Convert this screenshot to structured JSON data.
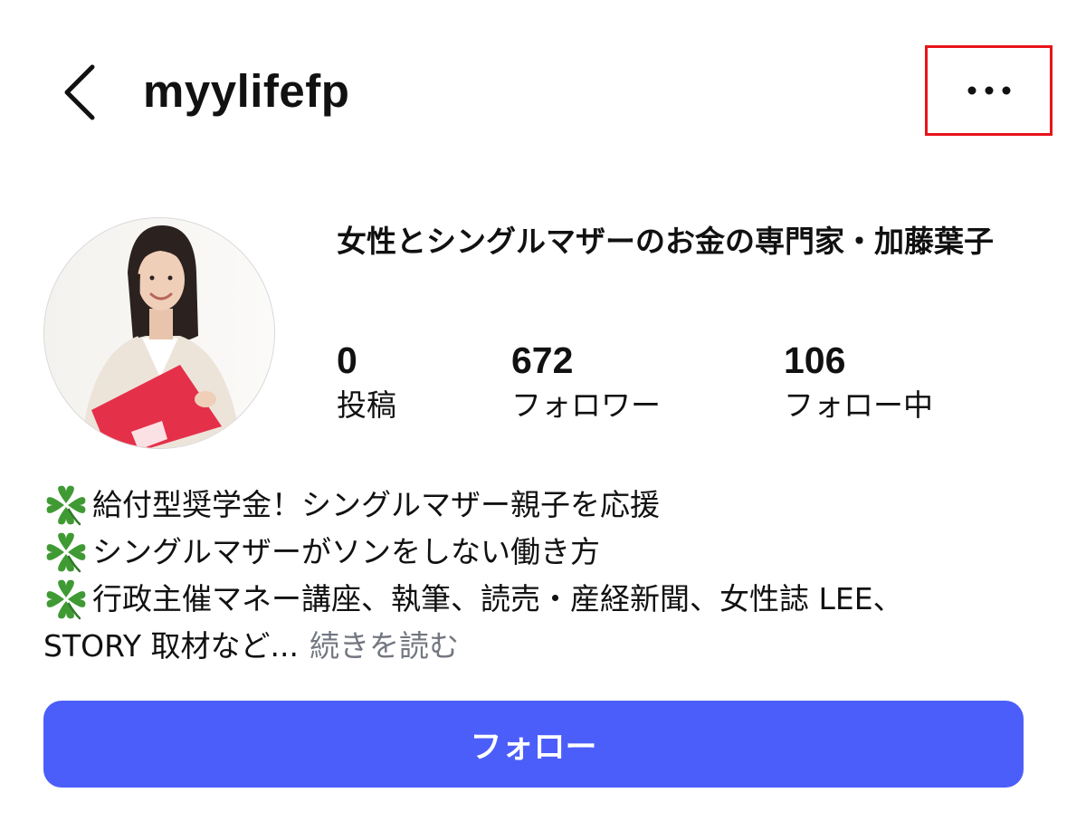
{
  "header": {
    "back_icon": "chevron-left-icon",
    "username": "myylifefp",
    "more_icon": "ellipsis-icon",
    "highlight_color": "#e8141b"
  },
  "profile": {
    "display_name": "女性とシングルマザーのお金の専門家・加藤葉子",
    "avatar_icon": "profile-photo-avatar",
    "stats": {
      "posts": {
        "value": "0",
        "label": "投稿"
      },
      "followers": {
        "value": "672",
        "label": "フォロワー"
      },
      "following": {
        "value": "106",
        "label": "フォロー中"
      }
    }
  },
  "bio": {
    "line_icon": "four-leaf-clover-icon",
    "lines": [
      "給付型奨学金！シングルマザー親子を応援",
      "シングルマザーがソンをしない働き方",
      "行政主催マネー講座、執筆、読売・産経新聞、女性誌 LEE、"
    ],
    "last_line": "STORY 取材など...",
    "read_more": "続きを読む",
    "read_more_color": "#737780"
  },
  "follow_button": {
    "label": "フォロー",
    "color": "#4c5ef9"
  }
}
